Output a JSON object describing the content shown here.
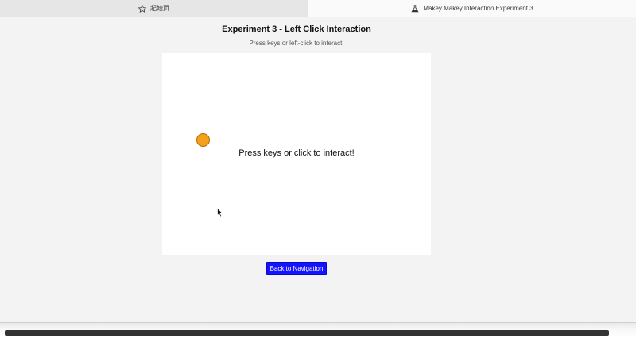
{
  "tabs": [
    {
      "label": "起始页",
      "icon": "star-icon",
      "active": false
    },
    {
      "label": "Makey Makey Interaction Experiment 3",
      "icon": "flask-icon",
      "active": true
    }
  ],
  "header": {
    "title": "Experiment 3 - Left Click Interaction",
    "subtitle": "Press keys or left-click to interact."
  },
  "canvas": {
    "message": "Press keys or click to interact!",
    "ball_color": "#f5a01a"
  },
  "actions": {
    "back_label": "Back to Navigation",
    "back_color": "#1414ff"
  }
}
